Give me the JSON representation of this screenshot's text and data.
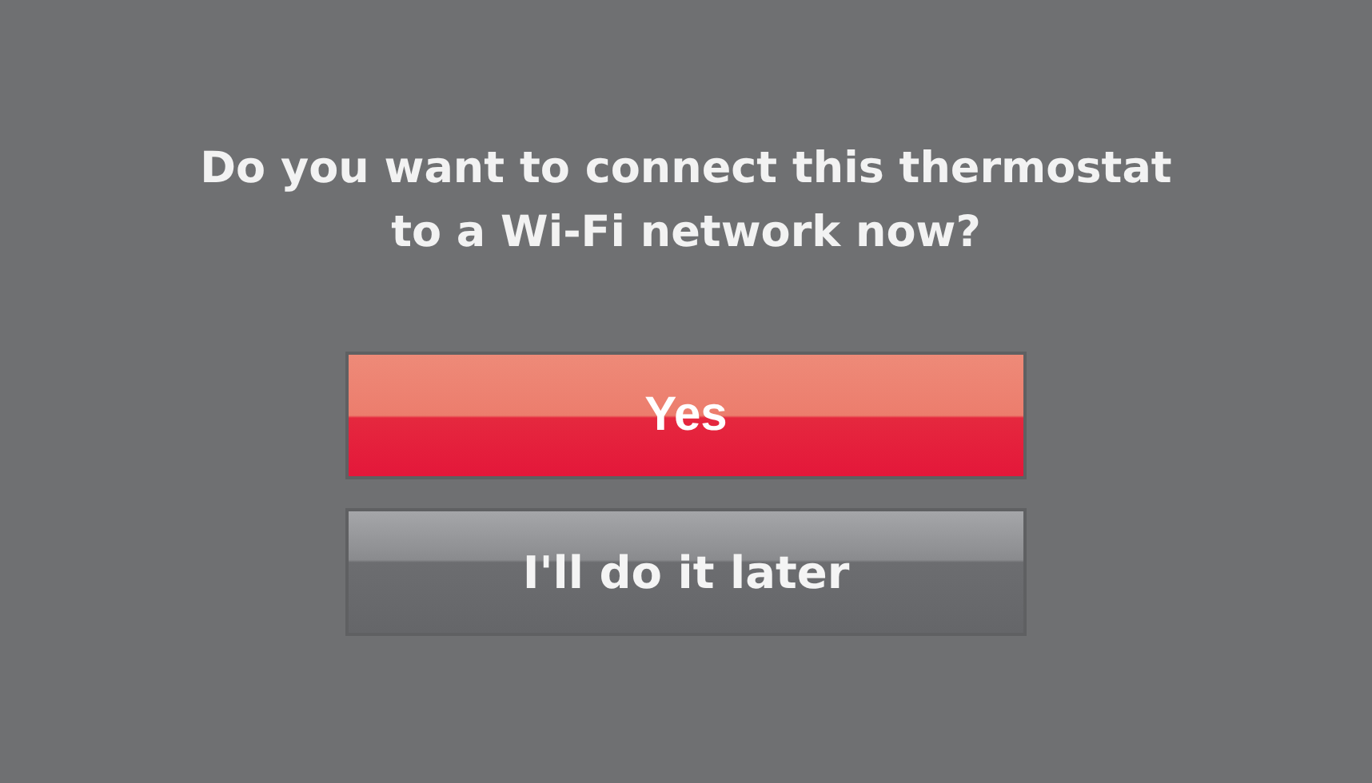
{
  "prompt": {
    "lines": [
      "Do you want to connect this thermostat",
      "to a Wi-Fi network now?"
    ]
  },
  "buttons": [
    {
      "label": "Yes",
      "kind": "primary"
    },
    {
      "label": "I'll do it later",
      "kind": "secondary"
    }
  ]
}
